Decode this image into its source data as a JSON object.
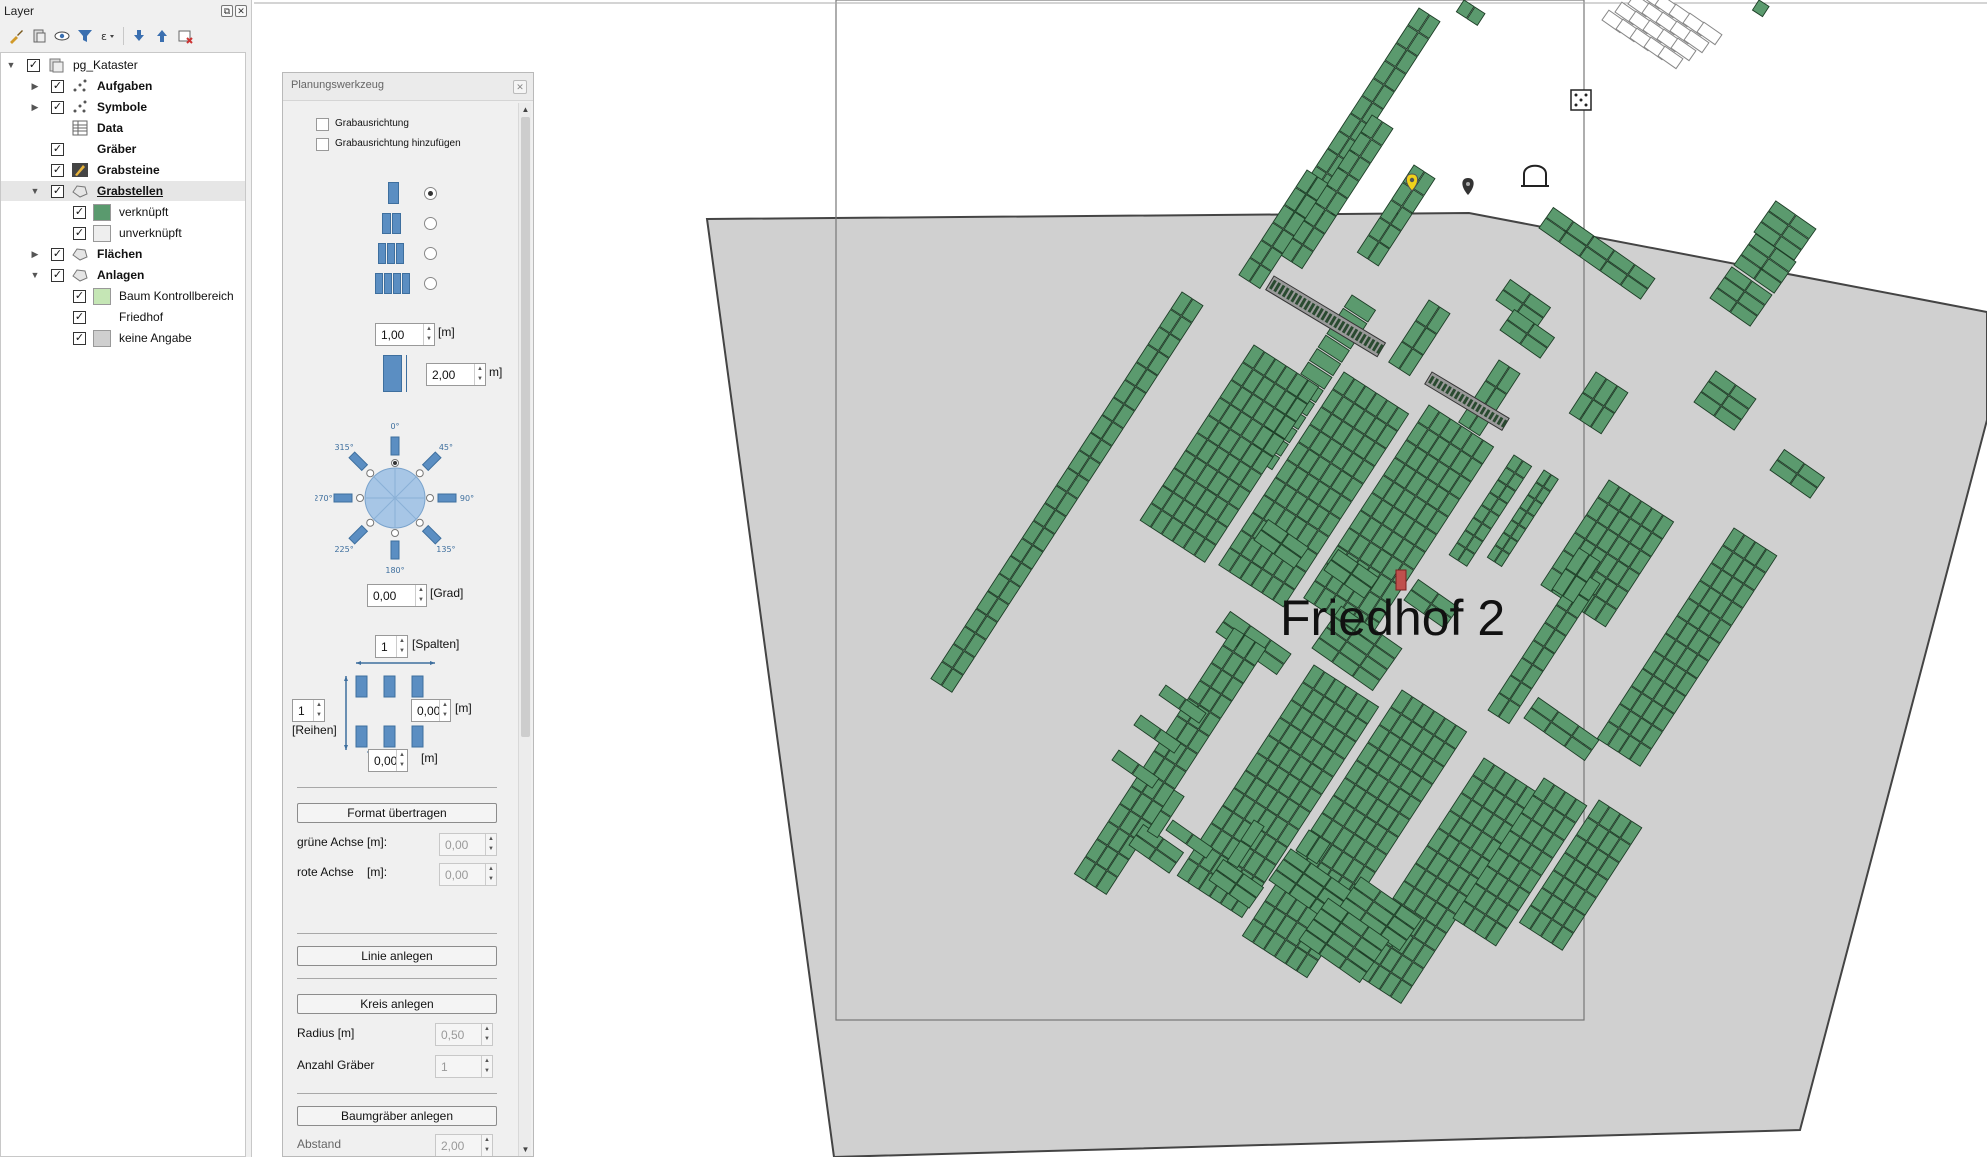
{
  "layer_panel": {
    "title": "Layer",
    "toolbar_icons": [
      "paintbrush-icon",
      "add-group-icon",
      "eye-icon",
      "filter-icon",
      "expression-filter-icon",
      "expand-all-icon",
      "collapse-all-icon",
      "remove-layer-icon"
    ],
    "tree": [
      {
        "label": "pg_Kataster",
        "level": 0,
        "checked": true,
        "expanded": true,
        "icon": "project-icon",
        "bold": false
      },
      {
        "label": "Aufgaben",
        "level": 1,
        "checked": true,
        "expanded": false,
        "icon": "point-layer-icon",
        "bold": true
      },
      {
        "label": "Symbole",
        "level": 1,
        "checked": true,
        "expanded": false,
        "icon": "point-layer-icon",
        "bold": true
      },
      {
        "label": "Data",
        "level": 1,
        "checked": null,
        "expanded": null,
        "icon": "table-icon",
        "bold": true
      },
      {
        "label": "Gräber",
        "level": 1,
        "checked": true,
        "expanded": null,
        "icon": "none",
        "bold": true
      },
      {
        "label": "Grabsteine",
        "level": 1,
        "checked": true,
        "expanded": null,
        "icon": "pencil-icon",
        "bold": true
      },
      {
        "label": "Grabstellen",
        "level": 1,
        "checked": true,
        "expanded": true,
        "icon": "polygon-icon",
        "bold": true,
        "selected": true
      },
      {
        "label": "verknüpft",
        "level": 2,
        "checked": true,
        "icon": "swatch",
        "swatch": "#5a9a6e"
      },
      {
        "label": "unverknüpft",
        "level": 2,
        "checked": true,
        "icon": "swatch",
        "swatch": "#eeeeee"
      },
      {
        "label": "Flächen",
        "level": 1,
        "checked": true,
        "expanded": false,
        "icon": "polygon-icon",
        "bold": true
      },
      {
        "label": "Anlagen",
        "level": 1,
        "checked": true,
        "expanded": true,
        "icon": "polygon-icon",
        "bold": true
      },
      {
        "label": "Baum Kontrollbereich",
        "level": 2,
        "checked": true,
        "icon": "swatch",
        "swatch": "#c5e6b5"
      },
      {
        "label": "Friedhof",
        "level": 2,
        "checked": true,
        "icon": "none"
      },
      {
        "label": "keine Angabe",
        "level": 2,
        "checked": true,
        "icon": "swatch",
        "swatch": "#cfcfcf"
      }
    ]
  },
  "planning": {
    "title": "Planungswerkzeug",
    "chk_orientation": "Grabausrichtung",
    "chk_add_orientation": "Grabausrichtung hinzufügen",
    "width_value": "1,00",
    "length_value": "2,00",
    "unit_m": "[m]",
    "unit_m_cut": "m]",
    "angle_labels": [
      "0°",
      "45°",
      "90°",
      "135°",
      "180°",
      "225°",
      "270°",
      "315°"
    ],
    "angle_value": "0,00",
    "angle_unit": "[Grad]",
    "columns_value": "1",
    "columns_label": "[Spalten]",
    "rows_value": "1",
    "rows_label": "[Reihen]",
    "col_spacing": "0,00",
    "row_spacing": "0,00",
    "btn_format": "Format übertragen",
    "green_axis_label": "grüne Achse [m]:",
    "green_axis_value": "0,00",
    "red_axis_label": "rote Achse    [m]:",
    "red_axis_value": "0,00",
    "btn_line": "Linie anlegen",
    "btn_circle": "Kreis anlegen",
    "radius_label": "Radius [m]",
    "radius_value": "0,50",
    "graves_count_label": "Anzahl Gräber",
    "graves_count_value": "1",
    "btn_tree_graves": "Baumgräber anlegen",
    "distance_label": "Abstand",
    "distance_value": "2,00"
  },
  "map": {
    "cemetery_label": "Friedhof 2",
    "grave_color": "#5b9a6e",
    "area_color": "#d0d0d0",
    "marker_icons": [
      "yellow-pin-icon",
      "grey-pin-icon",
      "bell-icon",
      "dice-icon"
    ]
  }
}
